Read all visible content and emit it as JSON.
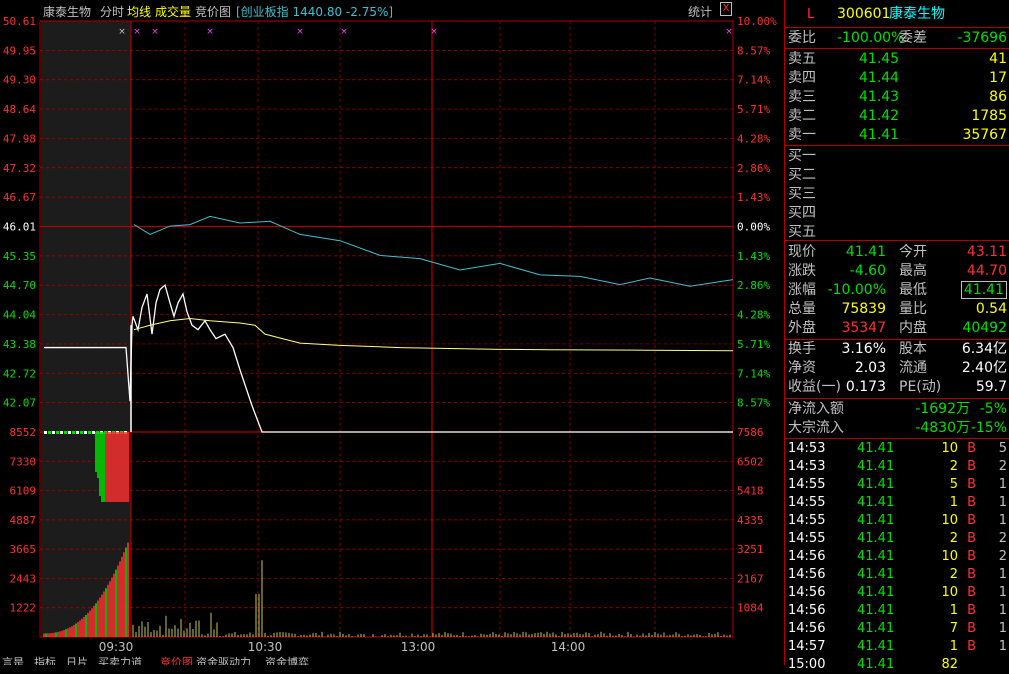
{
  "toolbar": {
    "stock_name": "康泰生物",
    "tabs": [
      "分时",
      "均线",
      "成交量",
      "竞价图"
    ],
    "index_info": "[创业板指 1440.80 -2.75%]",
    "stats_label": "统计",
    "close_label": "X"
  },
  "colors": {
    "up": "#ff3030",
    "down": "#00e000",
    "flat": "#ffffff",
    "grid": "#b00000",
    "avg_line": "#ffff80",
    "index_line": "#40c0d0",
    "label": "#c0c0c0",
    "yellow": "#ffff00",
    "cyan": "#00ffff"
  },
  "price_axis": {
    "left": [
      "50.61",
      "49.95",
      "49.30",
      "48.64",
      "47.98",
      "47.32",
      "46.67",
      "46.01",
      "45.35",
      "44.70",
      "44.04",
      "43.38",
      "42.72",
      "42.07"
    ],
    "right": [
      "10.00%",
      "8.57%",
      "7.14%",
      "5.71%",
      "4.28%",
      "2.86%",
      "1.43%",
      "0.00%",
      "1.43%",
      "2.86%",
      "4.28%",
      "5.71%",
      "7.14%",
      "8.57%"
    ]
  },
  "volume_axis": {
    "left": [
      "8552",
      "7330",
      "6109",
      "4887",
      "3665",
      "2443",
      "1222"
    ],
    "right": [
      "7586",
      "6502",
      "5418",
      "4335",
      "3251",
      "2167",
      "1084"
    ]
  },
  "time_labels": [
    "09:30",
    "10:30",
    "13:00",
    "14:00"
  ],
  "bottom_tabs": [
    "言是",
    "指标",
    "日片",
    "买卖力道",
    "竞价图",
    "资金驱动力",
    "资金博弈"
  ],
  "panel": {
    "flag": "L",
    "code": "300601",
    "name": "康泰生物",
    "weibi_label": "委比",
    "weibi_value": "-100.00%",
    "weicha_label": "委差",
    "weicha_value": "-37696",
    "asks": [
      {
        "label": "卖五",
        "price": "41.45",
        "vol": "41"
      },
      {
        "label": "卖四",
        "price": "41.44",
        "vol": "17"
      },
      {
        "label": "卖三",
        "price": "41.43",
        "vol": "86"
      },
      {
        "label": "卖二",
        "price": "41.42",
        "vol": "1785"
      },
      {
        "label": "卖一",
        "price": "41.41",
        "vol": "35767"
      }
    ],
    "bids": [
      "买一",
      "买二",
      "买三",
      "买四",
      "买五"
    ],
    "quote": [
      {
        "l1": "现价",
        "v1": "41.41",
        "l2": "今开",
        "v2": "43.11"
      },
      {
        "l1": "涨跌",
        "v1": "-4.60",
        "l2": "最高",
        "v2": "44.70"
      },
      {
        "l1": "涨幅",
        "v1": "-10.00%",
        "l2": "最低",
        "v2": "41.41"
      },
      {
        "l1": "总量",
        "v1": "75839",
        "l2": "量比",
        "v2": "0.54"
      },
      {
        "l1": "外盘",
        "v1": "35347",
        "l2": "内盘",
        "v2": "40492"
      }
    ],
    "fin": [
      {
        "l1": "换手",
        "v1": "3.16%",
        "l2": "股本",
        "v2": "6.34亿"
      },
      {
        "l1": "净资",
        "v1": "2.03",
        "l2": "流通",
        "v2": "2.40亿"
      },
      {
        "l1": "收益(一)",
        "v1": "0.173",
        "l2": "PE(动)",
        "v2": "59.7"
      }
    ],
    "flows": [
      {
        "label": "净流入额",
        "value": "-1692万",
        "pct": "-5%"
      },
      {
        "label": "大宗流入",
        "value": "-4830万",
        "pct": "-15%"
      }
    ],
    "trades": [
      {
        "time": "14:53",
        "price": "41.41",
        "vol": "10",
        "side": "B",
        "n": "5"
      },
      {
        "time": "14:53",
        "price": "41.41",
        "vol": "2",
        "side": "B",
        "n": "2"
      },
      {
        "time": "14:55",
        "price": "41.41",
        "vol": "5",
        "side": "B",
        "n": "1"
      },
      {
        "time": "14:55",
        "price": "41.41",
        "vol": "1",
        "side": "B",
        "n": "1"
      },
      {
        "time": "14:55",
        "price": "41.41",
        "vol": "10",
        "side": "B",
        "n": "1"
      },
      {
        "time": "14:55",
        "price": "41.41",
        "vol": "2",
        "side": "B",
        "n": "2"
      },
      {
        "time": "14:56",
        "price": "41.41",
        "vol": "10",
        "side": "B",
        "n": "2"
      },
      {
        "time": "14:56",
        "price": "41.41",
        "vol": "2",
        "side": "B",
        "n": "1"
      },
      {
        "time": "14:56",
        "price": "41.41",
        "vol": "10",
        "side": "B",
        "n": "1"
      },
      {
        "time": "14:56",
        "price": "41.41",
        "vol": "1",
        "side": "B",
        "n": "1"
      },
      {
        "time": "14:56",
        "price": "41.41",
        "vol": "7",
        "side": "B",
        "n": "1"
      },
      {
        "time": "14:57",
        "price": "41.41",
        "vol": "1",
        "side": "B",
        "n": "1"
      },
      {
        "time": "15:00",
        "price": "41.41",
        "vol": "82",
        "side": "",
        "n": ""
      }
    ]
  },
  "chart_data": {
    "type": "line",
    "price_range": [
      41.41,
      50.61
    ],
    "prev_close": 46.01,
    "series": [
      {
        "values": [
          44.0,
          43.7,
          44.2,
          44.5,
          43.6,
          44.3,
          44.6,
          44.7,
          44.3,
          44.0,
          44.3,
          44.5,
          44.1,
          43.8,
          43.7,
          43.9,
          43.7,
          43.5,
          43.6,
          43.3,
          42.8,
          42.0,
          41.41
        ]
      },
      {
        "values": [
          43.7,
          43.8,
          43.9,
          43.95,
          43.9,
          43.85,
          43.8,
          43.6,
          43.4,
          43.35,
          43.3,
          43.28,
          43.26,
          43.25,
          43.24,
          43.23
        ]
      },
      {
        "values": [
          0.0,
          -0.3,
          -0.1,
          0.3,
          0.5,
          0.4,
          0.2,
          -0.3,
          -1.0,
          -1.6,
          -2.1,
          -2.5,
          -2.4,
          -2.8,
          -3.2,
          -3.4,
          -3.3,
          -3.5,
          -3.4
        ]
      }
    ]
  }
}
